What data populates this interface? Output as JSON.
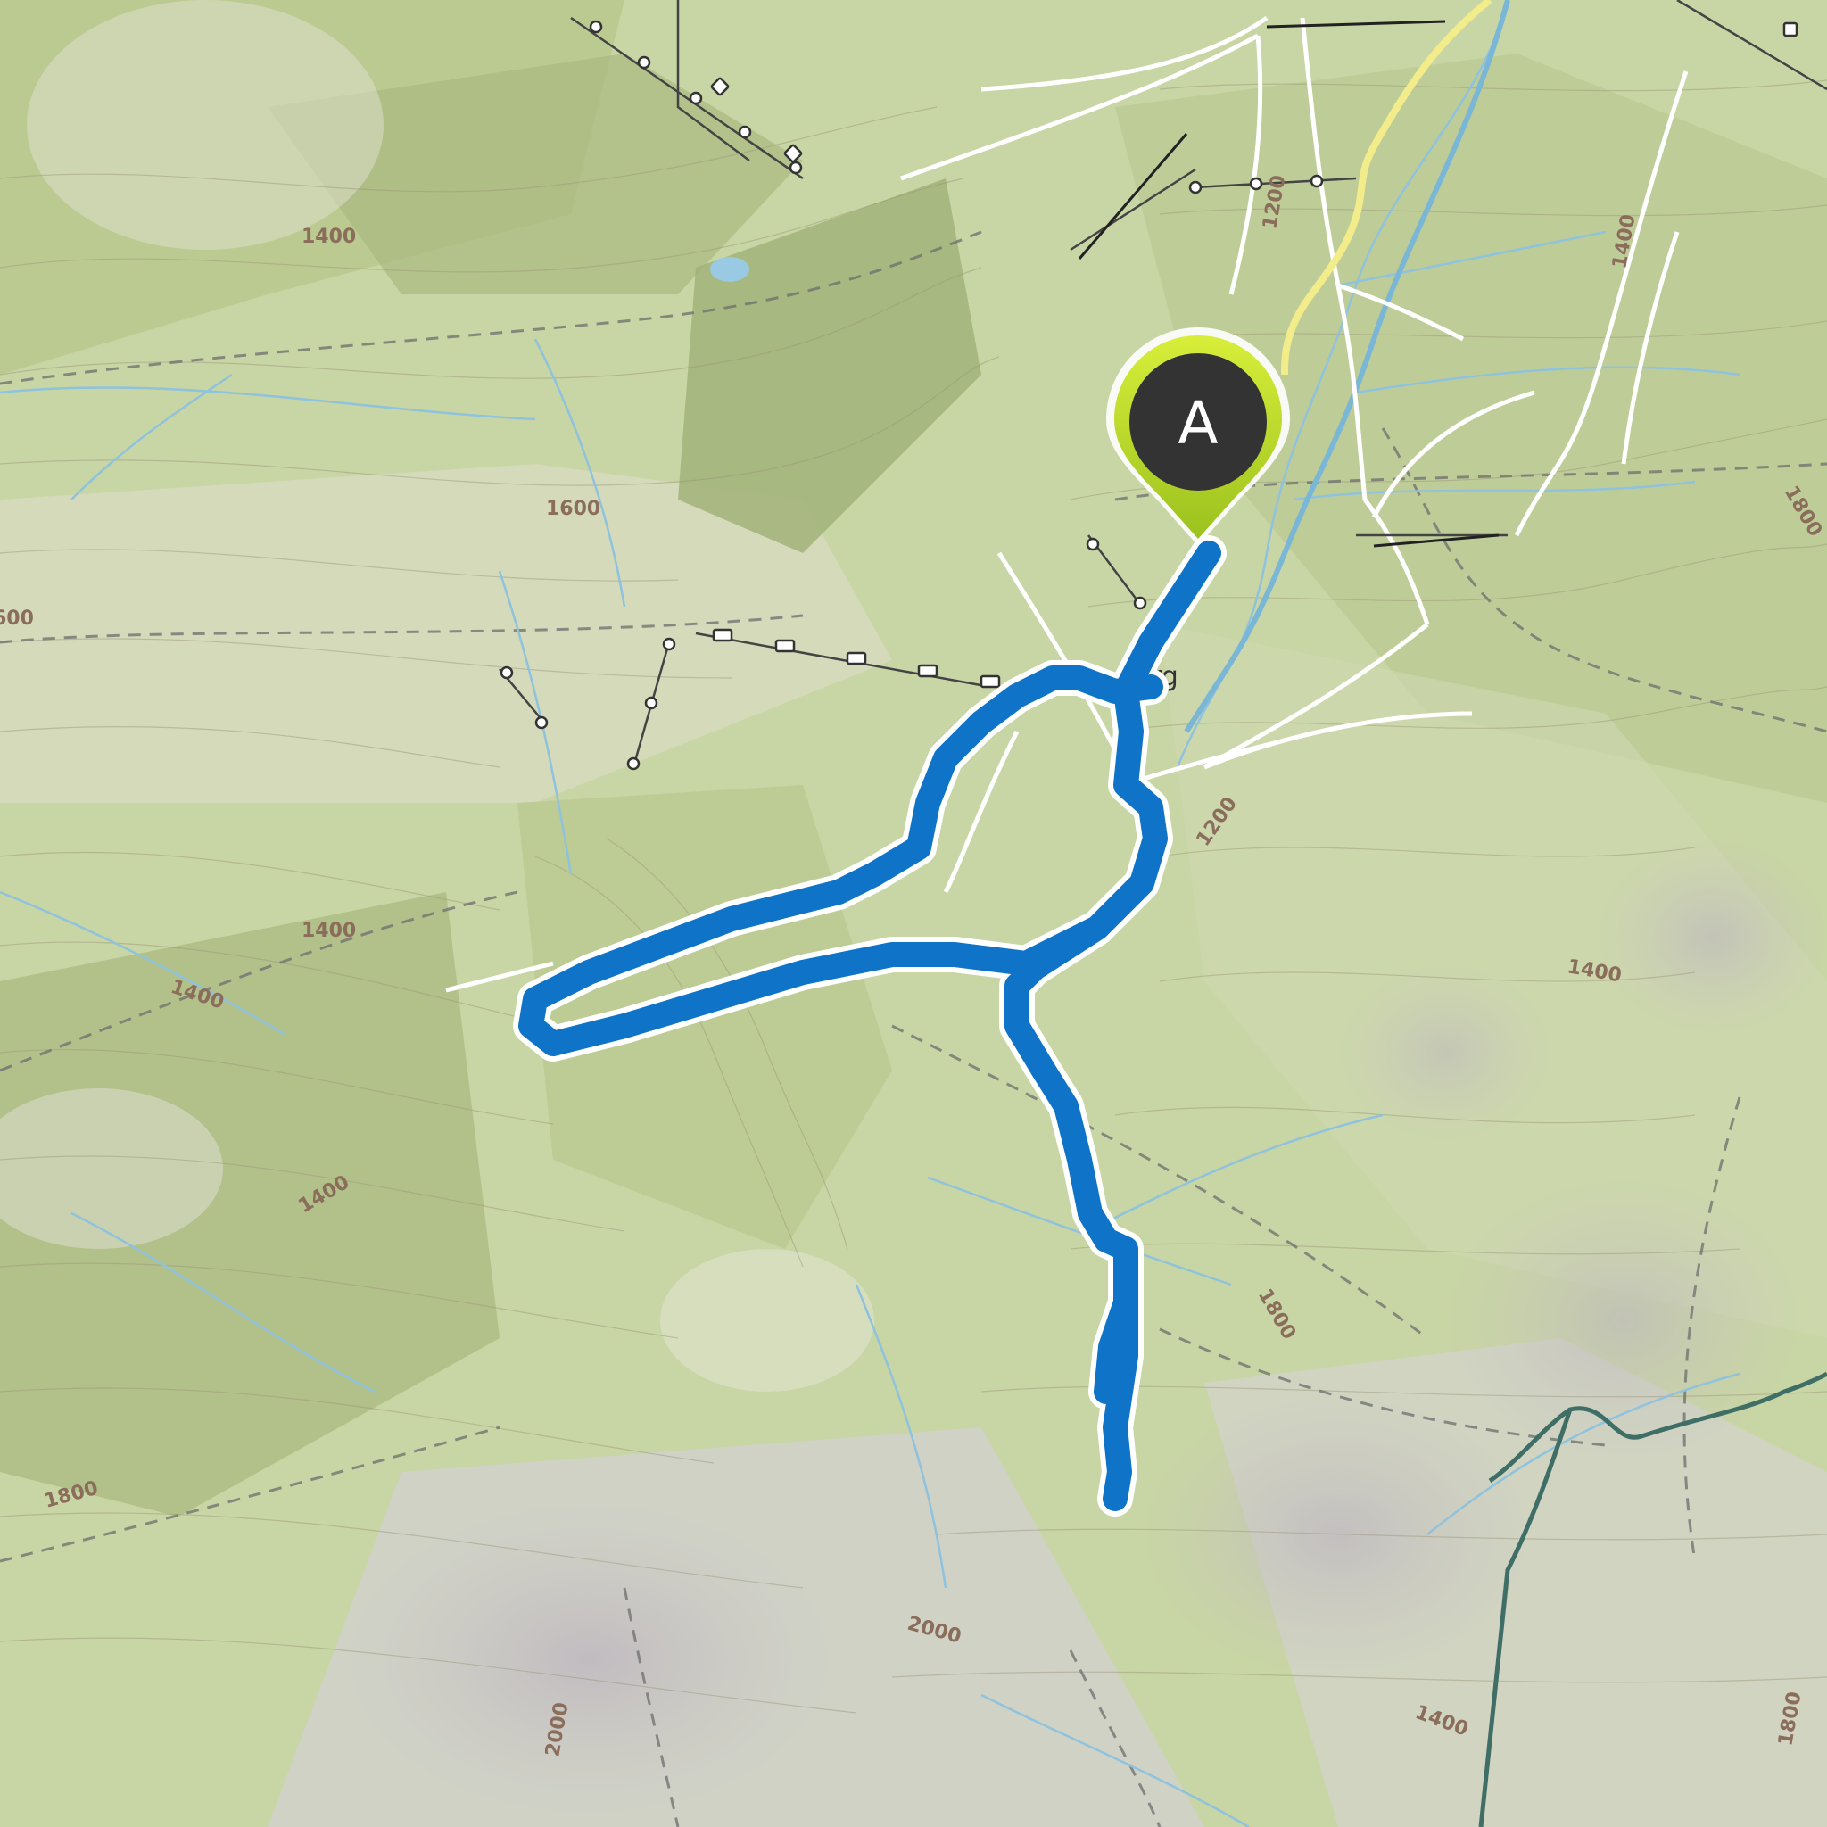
{
  "map": {
    "marker": {
      "letter": "A"
    },
    "place_labels": [
      "rg"
    ],
    "contour_labels": [
      "1400",
      "1600",
      "1400",
      "1400",
      "1400",
      "1400",
      "1800",
      "1800",
      "2000",
      "1200",
      "1400",
      "1800",
      "1400",
      "2000",
      "1800",
      "600",
      "1200"
    ]
  }
}
